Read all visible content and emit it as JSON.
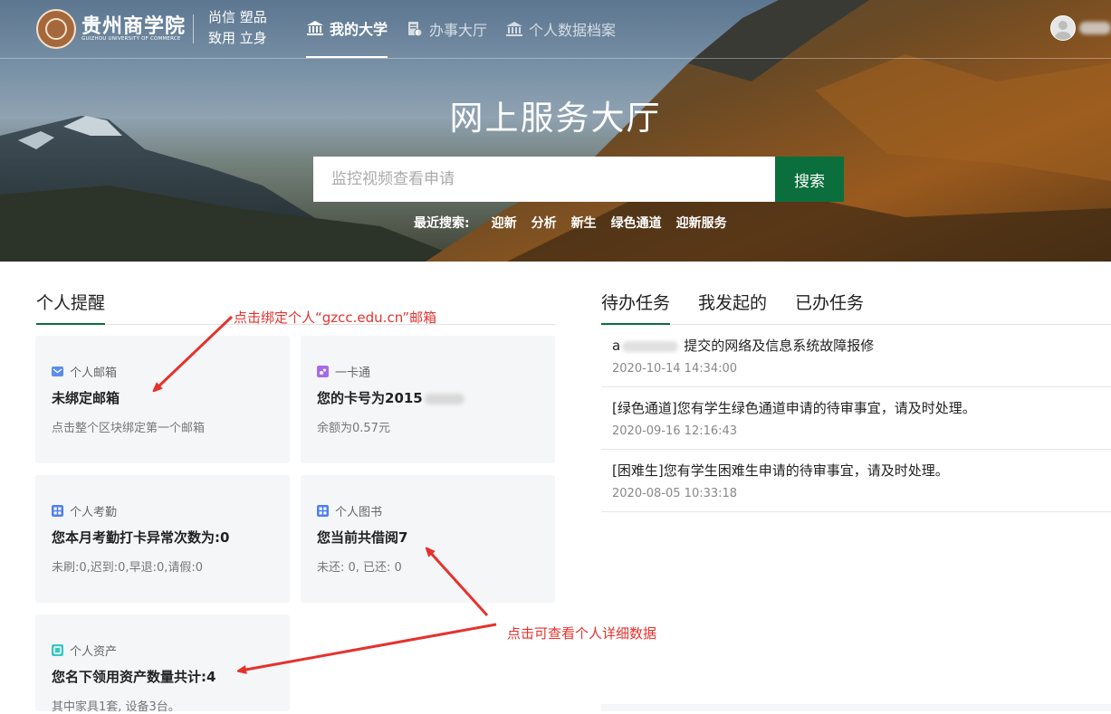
{
  "header": {
    "logo_text": "贵州商学院",
    "logo_sub": "GUIZHOU UNIVERSITY OF COMMERCE",
    "motto_line1": "尚信 塑品",
    "motto_line2": "致用 立身",
    "nav": [
      {
        "label": "我的大学",
        "icon": "building-icon",
        "active": true
      },
      {
        "label": "办事大厅",
        "icon": "document-icon",
        "active": false
      },
      {
        "label": "个人数据档案",
        "icon": "building-icon",
        "active": false
      }
    ]
  },
  "hero": {
    "title": "网上服务大厅",
    "search_placeholder": "监控视频查看申请",
    "search_button": "搜索",
    "recent_label": "最近搜索:",
    "recent_tags": [
      "迎新",
      "分析",
      "新生",
      "绿色通道",
      "迎新服务"
    ]
  },
  "reminders": {
    "title": "个人提醒",
    "cards": [
      {
        "type": "个人邮箱",
        "title": "未绑定邮箱",
        "desc": "点击整个区块绑定第一个邮箱",
        "icon": "mail-icon",
        "color": "#5b8def"
      },
      {
        "type": "一卡通",
        "title": "您的卡号为2015",
        "desc": "余额为0.57元",
        "icon": "card-icon",
        "color": "#a66bea"
      },
      {
        "type": "个人考勤",
        "title": "您本月考勤打卡异常次数为:0",
        "desc": "未刷:0,迟到:0,早退:0,请假:0",
        "icon": "grid-icon",
        "color": "#4d7ff0"
      },
      {
        "type": "个人图书",
        "title": "您当前共借阅7",
        "desc": "未还: 0, 已还: 0",
        "icon": "grid-icon",
        "color": "#4d7ff0"
      },
      {
        "type": "个人资产",
        "title": "您名下领用资产数量共计:4",
        "desc": "其中家具1套, 设备3台。",
        "icon": "asset-icon",
        "color": "#3cc6c0"
      }
    ]
  },
  "tasks": {
    "tabs": [
      "待办任务",
      "我发起的",
      "已办任务"
    ],
    "items": [
      {
        "prefix": "a",
        "text": "提交的网络及信息系统故障报修",
        "time": "2020-10-14 14:34:00"
      },
      {
        "prefix": "",
        "text": "[绿色通道]您有学生绿色通道申请的待审事宜，请及时处理。",
        "time": "2020-09-16 12:16:43"
      },
      {
        "prefix": "",
        "text": "[困难生]您有学生困难生申请的待审事宜，请及时处理。",
        "time": "2020-08-05 10:33:18"
      }
    ]
  },
  "annotations": {
    "mail_hint": "点击绑定个人“gzcc.edu.cn”邮箱",
    "detail_hint": "点击可查看个人详细数据",
    "color": "#e5322d"
  },
  "colors": {
    "brand_green": "#0b6e3d",
    "card_bg": "#f4f6f8"
  }
}
